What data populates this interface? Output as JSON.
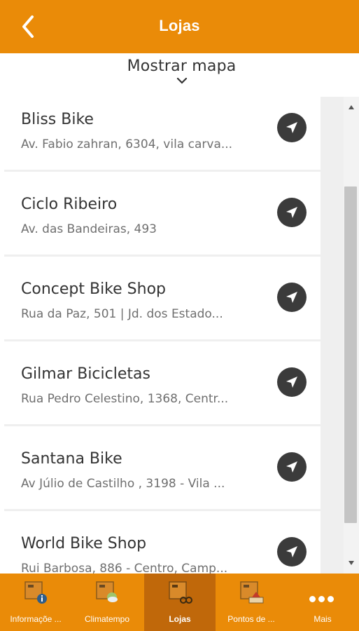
{
  "header": {
    "title": "Lojas",
    "back_icon": "chevron-left-icon"
  },
  "map_toggle": {
    "label": "Mostrar mapa",
    "icon": "chevron-down-icon"
  },
  "stores": [
    {
      "name": "Bliss Bike",
      "address": "Av. Fabio zahran, 6304, vila carva..."
    },
    {
      "name": "Ciclo Ribeiro",
      "address": "Av. das Bandeiras, 493"
    },
    {
      "name": "Concept Bike Shop",
      "address": "Rua da Paz, 501 | Jd. dos Estado..."
    },
    {
      "name": "Gilmar Bicicletas",
      "address": "Rua Pedro Celestino, 1368, Centr..."
    },
    {
      "name": "Santana Bike",
      "address": "Av Júlio de Castilho , 3198 - Vila ..."
    },
    {
      "name": "World Bike Shop",
      "address": "Rui Barbosa, 886 - Centro, Camp..."
    }
  ],
  "tabs": [
    {
      "label": "Informaçõe ...",
      "icon": "info-icon"
    },
    {
      "label": "Climatempo",
      "icon": "weather-icon"
    },
    {
      "label": "Lojas",
      "icon": "store-icon",
      "active": true
    },
    {
      "label": "Pontos de ...",
      "icon": "points-icon"
    },
    {
      "label": "Mais",
      "icon": "more-icon"
    }
  ],
  "colors": {
    "accent": "#ea8b08",
    "active_tab": "#c0680a",
    "nav_button": "#3b3b3b"
  }
}
